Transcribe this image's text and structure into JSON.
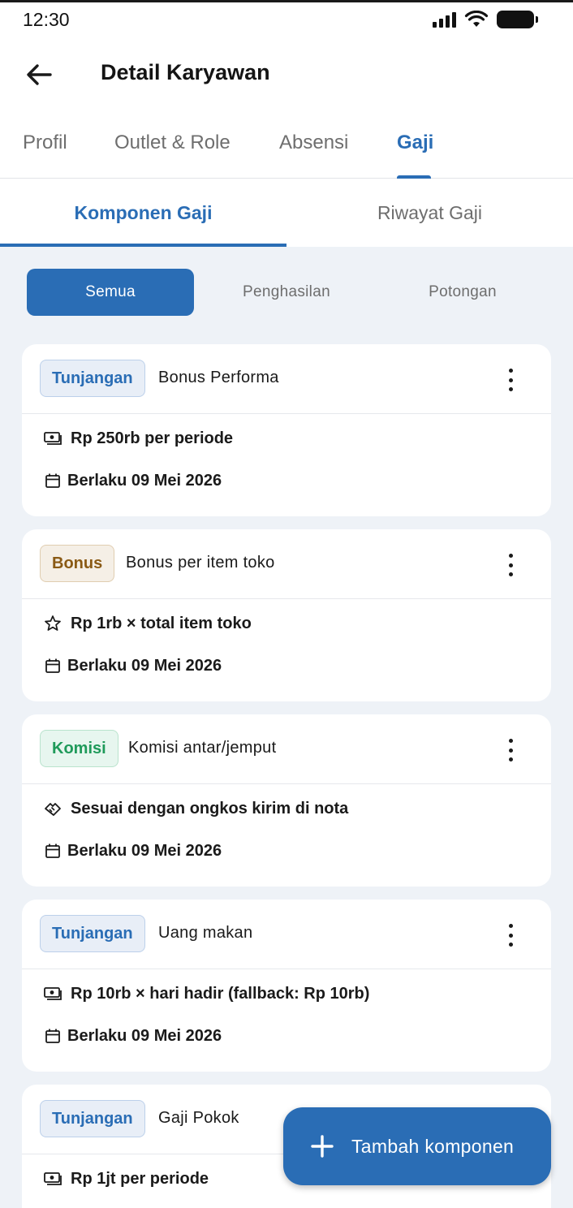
{
  "status_bar": {
    "time": "12:30"
  },
  "header": {
    "title": "Detail Karyawan"
  },
  "main_tabs": [
    {
      "label": "Profil"
    },
    {
      "label": "Outlet & Role"
    },
    {
      "label": "Absensi"
    },
    {
      "label": "Gaji",
      "active": true
    }
  ],
  "sub_tabs": [
    {
      "label": "Komponen Gaji",
      "active": true
    },
    {
      "label": "Riwayat Gaji"
    }
  ],
  "filters": [
    {
      "label": "Semua",
      "active": true
    },
    {
      "label": "Penghasilan"
    },
    {
      "label": "Potongan"
    }
  ],
  "components": [
    {
      "type": "Tunjangan",
      "name": "Bonus Performa",
      "icon": "money-icon",
      "amount": "Rp 250rb per periode",
      "effective": "Berlaku 09 Mei 2026"
    },
    {
      "type": "Bonus",
      "name": "Bonus per item toko",
      "icon": "star-icon",
      "amount": "Rp 1rb × total item toko",
      "effective": "Berlaku 09 Mei 2026"
    },
    {
      "type": "Komisi",
      "name": "Komisi antar/jemput",
      "icon": "handshake-icon",
      "amount": "Sesuai dengan ongkos kirim di nota",
      "effective": "Berlaku 09 Mei 2026"
    },
    {
      "type": "Tunjangan",
      "name": "Uang makan",
      "icon": "money-icon",
      "amount": "Rp 10rb × hari hadir (fallback: Rp 10rb)",
      "effective": "Berlaku 09 Mei 2026"
    },
    {
      "type": "Tunjangan",
      "name": "Gaji Pokok",
      "icon": "money-icon",
      "amount": "Rp 1jt per periode",
      "effective": ""
    }
  ],
  "fab": {
    "label": "Tambah komponen",
    "icon": "plus-icon"
  },
  "colors": {
    "primary": "#2a6db5",
    "background": "#eef2f7",
    "tunjangan": "#2a6db5",
    "bonus": "#8a5a15",
    "komisi": "#1f9a5a"
  }
}
